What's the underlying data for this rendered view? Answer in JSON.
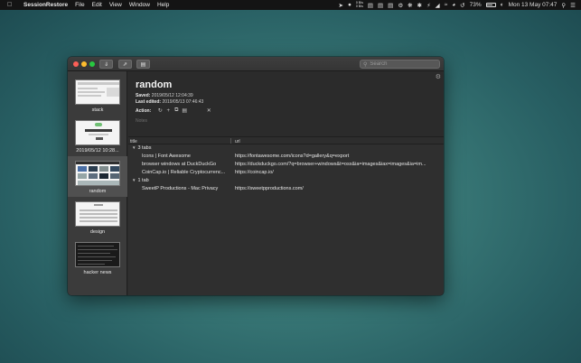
{
  "menubar": {
    "app_name": "SessionRestore",
    "items": [
      "File",
      "Edit",
      "View",
      "Window",
      "Help"
    ],
    "net_up": "0 B/s",
    "net_down": "0 B/s",
    "battery_percent": "73%",
    "battery_level": 0.73,
    "clock": "Mon 13 May  07:47"
  },
  "window": {
    "search_placeholder": "Search"
  },
  "sidebar": {
    "sessions": [
      {
        "label": "stack",
        "selected": false
      },
      {
        "label": "2019/05/12 10:28...",
        "selected": false
      },
      {
        "label": "random",
        "selected": true
      },
      {
        "label": "design",
        "selected": false
      },
      {
        "label": "hacker news",
        "selected": false
      }
    ]
  },
  "detail": {
    "title": "random",
    "saved_label": "Saved:",
    "saved_value": "2019/05/12 12:04:39",
    "edited_label": "Last edited:",
    "edited_value": "2019/05/13 07:46:43",
    "action_label": "Action:",
    "notes_placeholder": "Notes"
  },
  "table": {
    "col_title": "title",
    "col_url": "url",
    "groups": [
      {
        "label": "3 tabs",
        "rows": [
          {
            "title": "Icons | Font Awesome",
            "url": "https://fontawesome.com/icons?d=gallery&q=export"
          },
          {
            "title": "browser windows at DuckDuckGo",
            "url": "https://duckduckgo.com/?q=browser+windows&t=osx&ia=images&iax=images&ia=im..."
          },
          {
            "title": "CoinCap.io | Reliable Cryptocurrenc...",
            "url": "https://coincap.io/"
          }
        ]
      },
      {
        "label": "1 tab",
        "rows": [
          {
            "title": "SweetP Productions - Mac Privacy",
            "url": "https://sweetpproductions.com/"
          }
        ]
      }
    ]
  }
}
